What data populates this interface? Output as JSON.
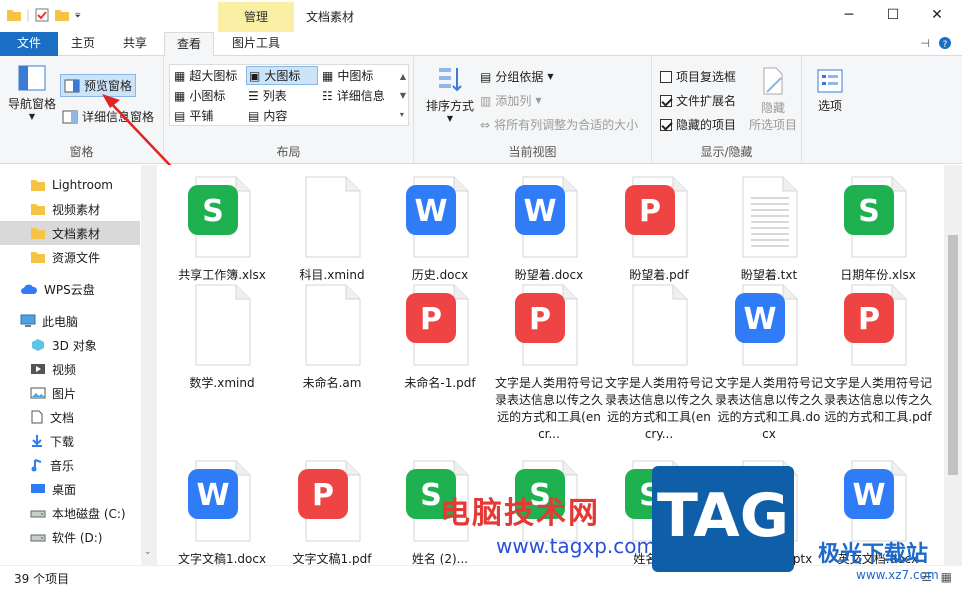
{
  "window": {
    "title": "文档素材",
    "context_tab": "管理",
    "controls": [
      "─",
      "☐",
      "✕"
    ]
  },
  "tabs": {
    "file": "文件",
    "home": "主页",
    "share": "共享",
    "view": "查看",
    "picture_tools": "图片工具"
  },
  "ribbon": {
    "panes": {
      "nav_pane": "导航窗格",
      "preview_pane": "预览窗格",
      "details_pane": "详细信息窗格",
      "label": "窗格"
    },
    "layout": {
      "items": [
        "超大图标",
        "大图标",
        "中图标",
        "小图标",
        "列表",
        "详细信息",
        "平铺",
        "内容"
      ],
      "selected": "大图标",
      "label": "布局"
    },
    "current_view": {
      "sort": "排序方式",
      "group_by": "分组依据",
      "add_columns": "添加列",
      "fit_columns": "将所有列调整为合适的大小",
      "label": "当前视图"
    },
    "show_hide": {
      "item_checkboxes": "项目复选框",
      "file_extensions": "文件扩展名",
      "hidden_items": "隐藏的项目",
      "hide_selected_line1": "隐藏",
      "hide_selected_line2": "所选项目",
      "options": "选项",
      "label": "显示/隐藏",
      "checked": {
        "item_checkboxes": false,
        "file_extensions": true,
        "hidden_items": true
      }
    }
  },
  "nav": {
    "items": [
      {
        "label": "Lightroom",
        "icon": "folder-icon"
      },
      {
        "label": "视频素材",
        "icon": "folder-icon"
      },
      {
        "label": "文档素材",
        "icon": "folder-icon",
        "selected": true
      },
      {
        "label": "资源文件",
        "icon": "folder-icon"
      },
      {
        "label": "WPS云盘",
        "icon": "cloud-icon"
      },
      {
        "label": "此电脑",
        "icon": "computer-icon"
      },
      {
        "label": "3D 对象",
        "icon": "cube-icon"
      },
      {
        "label": "视频",
        "icon": "video-icon"
      },
      {
        "label": "图片",
        "icon": "picture-icon"
      },
      {
        "label": "文档",
        "icon": "document-icon"
      },
      {
        "label": "下载",
        "icon": "download-icon"
      },
      {
        "label": "音乐",
        "icon": "music-icon"
      },
      {
        "label": "桌面",
        "icon": "desktop-icon"
      },
      {
        "label": "本地磁盘 (C:)",
        "icon": "drive-icon"
      },
      {
        "label": "软件 (D:)",
        "icon": "drive-icon"
      }
    ]
  },
  "files": [
    {
      "name": "共享工作簿.xlsx",
      "type": "xlsx"
    },
    {
      "name": "科目.xmind",
      "type": "blank"
    },
    {
      "name": "历史.docx",
      "type": "docx"
    },
    {
      "name": "盼望着.docx",
      "type": "docx"
    },
    {
      "name": "盼望着.pdf",
      "type": "pdf"
    },
    {
      "name": "盼望着.txt",
      "type": "txt"
    },
    {
      "name": "日期年份.xlsx",
      "type": "xlsx"
    },
    {
      "name": "数学.xmind",
      "type": "blank"
    },
    {
      "name": "未命名.am",
      "type": "blank"
    },
    {
      "name": "未命名-1.pdf",
      "type": "pdf"
    },
    {
      "name": "文字是人类用符号记录表达信息以传之久远的方式和工具(encr...",
      "type": "pdf"
    },
    {
      "name": "文字是人类用符号记录表达信息以传之久远的方式和工具(encry...",
      "type": "blank"
    },
    {
      "name": "文字是人类用符号记录表达信息以传之久远的方式和工具.docx",
      "type": "docx"
    },
    {
      "name": "文字是人类用符号记录表达信息以传之久远的方式和工具.pdf",
      "type": "pdf"
    },
    {
      "name": "文字文稿1.docx",
      "type": "docx"
    },
    {
      "name": "文字文稿1.pdf",
      "type": "pdf"
    },
    {
      "name": "姓名 (2)...",
      "type": "xlsx"
    },
    {
      "name": "",
      "type": "xlsx"
    },
    {
      "name": "姓名.xlsx",
      "type": "xlsx"
    },
    {
      "name": "演示文稿1.pptx",
      "type": "pptx"
    },
    {
      "name": "英文文档.docx",
      "type": "docx"
    }
  ],
  "status": {
    "count": "39 个项目"
  },
  "watermark": {
    "site": "电脑技术网",
    "url": "www.tagxp.com",
    "tag": "TAG",
    "jg": "极光下载站",
    "url2": "www.xz7.com"
  },
  "colors": {
    "docx": "#2f7cf6",
    "pdf": "#ef4444",
    "xlsx": "#1fb14f",
    "pptx": "#f97316",
    "file_tab": "#1a6ec4",
    "ctx_tab": "#fbeea5"
  }
}
